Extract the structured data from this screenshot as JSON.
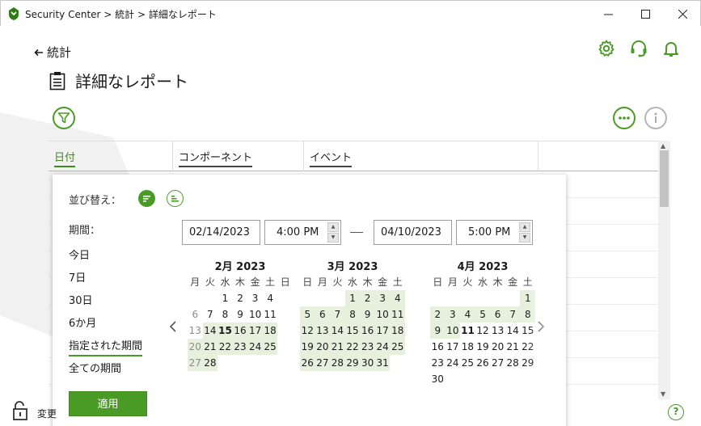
{
  "window": {
    "title": "Security Center > 統計 > 詳細なレポート"
  },
  "header": {
    "back_label": "統計",
    "page_title": "詳細なレポート"
  },
  "table": {
    "columns": [
      "日付",
      "コンポーネント",
      "イベント"
    ]
  },
  "popup": {
    "sort_label": "並び替え：",
    "period_label": "期間：",
    "periods": [
      "今日",
      "7日",
      "30日",
      "6か月",
      "指定された期間",
      "全ての期間"
    ],
    "selected_period": "指定された期間",
    "start_date": "02/14/2023",
    "start_time": "4:00 PM",
    "end_date": "04/10/2023",
    "end_time": "5:00 PM",
    "apply_label": "適用",
    "weekdays": [
      "月",
      "火",
      "水",
      "木",
      "金",
      "土",
      "日"
    ],
    "weekdays_sun": [
      "日",
      "月",
      "火",
      "水",
      "木",
      "金",
      "土"
    ],
    "months": [
      {
        "title": "2月 2023",
        "weeks": [
          [
            "",
            "",
            "1",
            "2",
            "3",
            "4",
            ""
          ],
          [
            "6",
            "7",
            "8",
            "9",
            "10",
            "11",
            ""
          ],
          [
            "13",
            "14",
            "15",
            "16",
            "17",
            "18",
            ""
          ],
          [
            "20",
            "21",
            "22",
            "23",
            "24",
            "25",
            ""
          ],
          [
            "27",
            "28",
            "",
            "",
            "",
            "",
            ""
          ]
        ]
      },
      {
        "title": "3月 2023",
        "weeks": [
          [
            "",
            "",
            "",
            "1",
            "2",
            "3",
            "4"
          ],
          [
            "5",
            "6",
            "7",
            "8",
            "9",
            "10",
            "11"
          ],
          [
            "12",
            "13",
            "14",
            "15",
            "16",
            "17",
            "18"
          ],
          [
            "19",
            "20",
            "21",
            "22",
            "23",
            "24",
            "25"
          ],
          [
            "26",
            "27",
            "28",
            "29",
            "30",
            "31",
            ""
          ]
        ]
      },
      {
        "title": "4月 2023",
        "weeks": [
          [
            "",
            "",
            "",
            "",
            "",
            "",
            "1"
          ],
          [
            "2",
            "3",
            "4",
            "5",
            "6",
            "7",
            "8"
          ],
          [
            "9",
            "10",
            "11",
            "12",
            "13",
            "14",
            "15"
          ],
          [
            "16",
            "17",
            "18",
            "19",
            "20",
            "21",
            "22"
          ],
          [
            "23",
            "24",
            "25",
            "26",
            "27",
            "28",
            "29"
          ],
          [
            "30",
            "",
            "",
            "",
            "",
            "",
            ""
          ]
        ]
      }
    ]
  },
  "footer": {
    "text": "変更"
  },
  "colors": {
    "accent": "#4a9b25",
    "range_bg": "#e6f0dc"
  },
  "icons": [
    "app-logo-icon",
    "minimize-icon",
    "maximize-icon",
    "close-icon",
    "back-arrow-icon",
    "report-clipboard-icon",
    "settings-gear-icon",
    "support-headset-icon",
    "notifications-bell-icon",
    "filter-icon",
    "more-options-icon",
    "info-icon",
    "sort-desc-icon",
    "sort-asc-icon",
    "chevron-left-icon",
    "chevron-right-icon",
    "lock-icon",
    "help-icon"
  ]
}
